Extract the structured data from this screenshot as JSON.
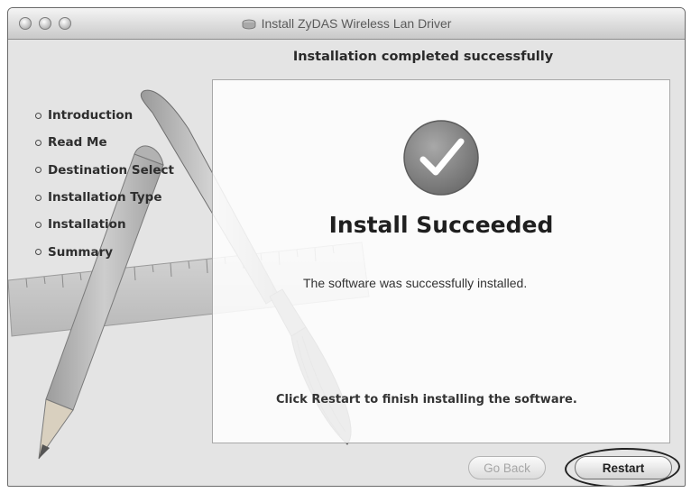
{
  "window": {
    "title": "Install ZyDAS Wireless Lan Driver",
    "header": "Installation completed successfully"
  },
  "sidebar": {
    "steps": [
      {
        "label": "Introduction"
      },
      {
        "label": "Read Me"
      },
      {
        "label": "Destination Select"
      },
      {
        "label": "Installation Type"
      },
      {
        "label": "Installation"
      },
      {
        "label": "Summary"
      }
    ]
  },
  "main": {
    "status_title": "Install Succeeded",
    "status_message": "The software was successfully installed.",
    "restart_message": "Click Restart to finish installing the software."
  },
  "buttons": {
    "back": "Go Back",
    "restart": "Restart"
  },
  "icons": {
    "checkmark": "checkmark-icon",
    "title_disk": "disk-icon"
  },
  "colors": {
    "window_bg": "#e4e4e4",
    "check_circle": "#7a7a7a"
  }
}
